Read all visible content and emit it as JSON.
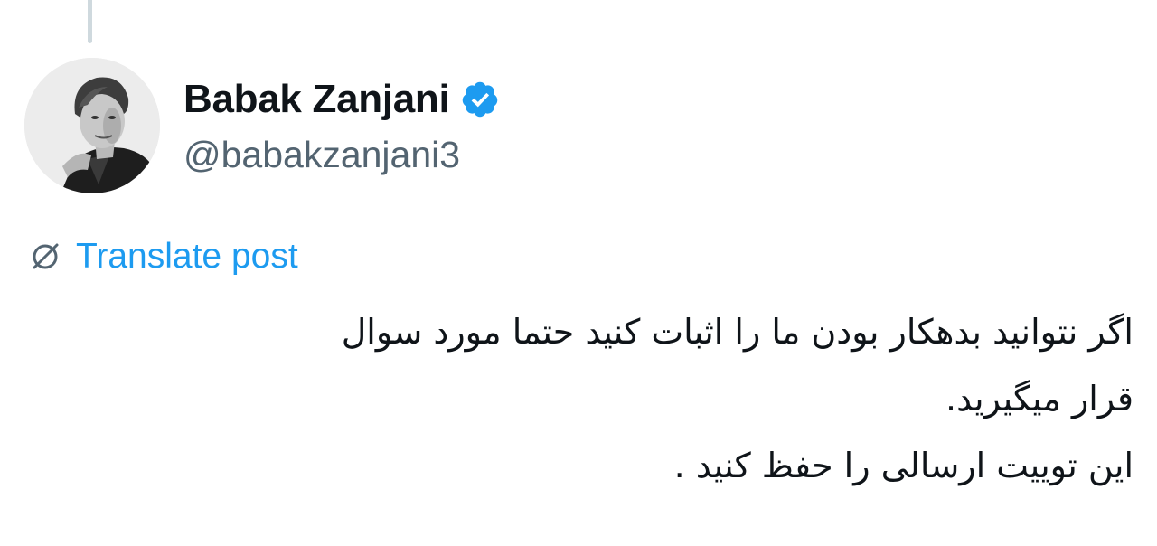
{
  "post": {
    "author": {
      "display_name": "Babak Zanjani",
      "handle": "@babakzanjani3",
      "verified": true,
      "verified_badge_color": "#1d9bf0",
      "avatar_style": "grayscale-photo"
    },
    "translate_label": "Translate post",
    "text_lines": [
      "اگر نتوانید بدهکار بودن ما را اثبات کنید حتما مورد سوال",
      "قرار میگیرید.",
      "این توییت ارسالی را حفظ کنید ."
    ]
  },
  "colors": {
    "background": "#ffffff",
    "primary_text": "#0f1419",
    "secondary_text": "#536471",
    "link": "#1d9bf0",
    "thread_line": "#cfd9de"
  },
  "icons": {
    "verified": "verified-badge-icon",
    "translate": "globe-icon"
  }
}
